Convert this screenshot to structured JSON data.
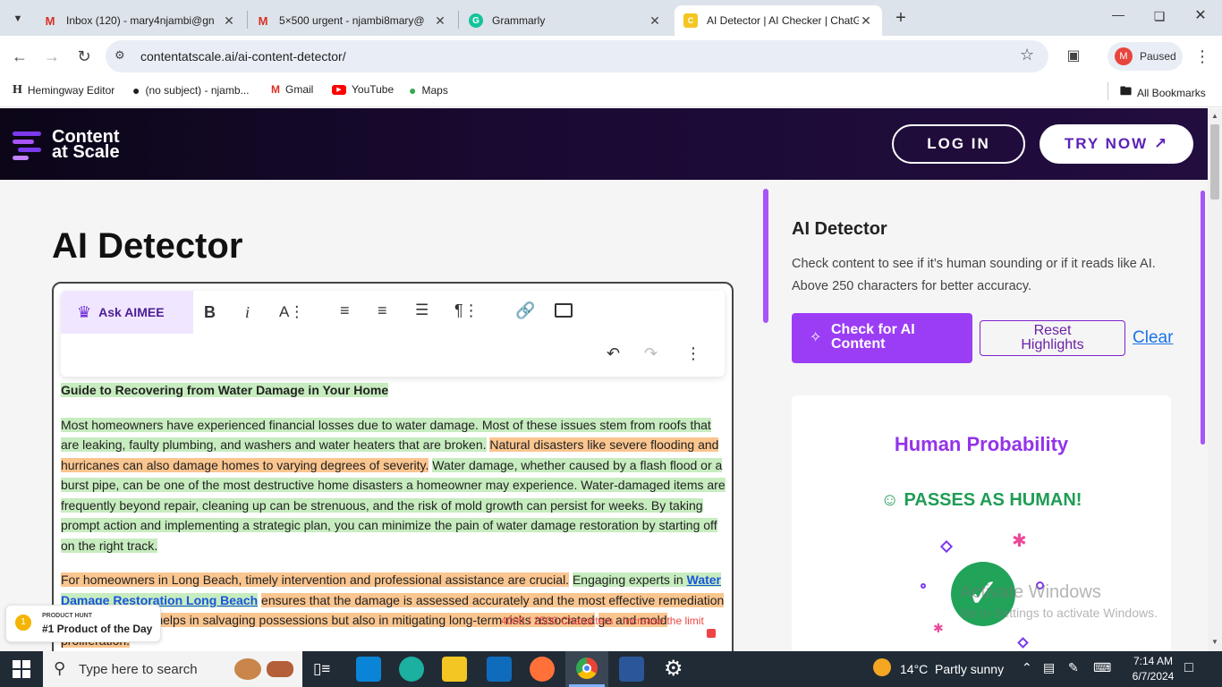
{
  "browser": {
    "tabs": [
      {
        "title": "Inbox (120) - mary4njambi@gn",
        "icon": "gmail-icon"
      },
      {
        "title": "5×500 urgent - njambi8mary@",
        "icon": "gmail-icon"
      },
      {
        "title": "Grammarly",
        "icon": "grammarly-icon"
      },
      {
        "title": "AI Detector | AI Checker | ChatG",
        "icon": "contentatscale-icon"
      }
    ],
    "url": "contentatscale.ai/ai-content-detector/",
    "profile_initial": "M",
    "profile_status": "Paused",
    "bookmarks": [
      {
        "label": "Hemingway Editor",
        "icon": "H"
      },
      {
        "label": "(no subject) - njamb...",
        "icon": ""
      },
      {
        "label": "Gmail",
        "icon": "M"
      },
      {
        "label": "YouTube",
        "icon": ""
      },
      {
        "label": "Maps",
        "icon": ""
      }
    ],
    "all_bookmarks": "All Bookmarks"
  },
  "site": {
    "logo_line1": "Content",
    "logo_line2": "at Scale",
    "login": "LOG IN",
    "try_now": "TRY NOW ↗"
  },
  "editor": {
    "page_title": "AI Detector",
    "ask_aimee": "Ask AIMEE",
    "heading": "Guide to Recovering from Water Damage in Your Home",
    "p1_green1": "Most homeowners have experienced financial losses due to water damage. Most of these issues stem from roofs that are leaking, faulty plumbing, and washers and water heaters that are broken.",
    "p1_orange": "Natural disasters like severe flooding and hurricanes can also damage homes to varying degrees of severity.",
    "p1_green2": "Water damage, whether caused by a flash flood or a burst pipe, can be one of the most destructive home disasters a homeowner may experience. Water-damaged items are frequently beyond repair, cleaning up can be strenuous, and the risk of mold growth can persist for weeks. By taking prompt action and implementing a strategic plan, you can minimize the pain of water damage restoration by starting off on the right track.",
    "p2_orange1": "For homeowners in Long Beach, timely intervention and professional assistance are crucial.",
    "p2_green_pre": "Engaging experts in",
    "p2_link": "Water Damage Restoration Long Beach",
    "p2_orange2_a": "ensures that the damage is assessed accurately and the most effective remediation",
    "p2_orange2_b": "ed. This not only helps in salvaging possessions but also in mitigating long-term risks associated",
    "p2_orange2_c": "ge and mold proliferation.",
    "char_count": "4000 / 2500 Characters - Increase the limit"
  },
  "product_hunt": {
    "small": "PRODUCT HUNT",
    "label": "#1 Product of the Day"
  },
  "detector": {
    "title": "AI Detector",
    "description": "Check content to see if it’s human sounding or if it reads like AI. Above 250 characters for better accuracy.",
    "check_btn": "Check for AI Content",
    "reset_btn": "Reset Highlights",
    "clear": "Clear",
    "result_title": "Human Probability",
    "result_status": "PASSES AS HUMAN!"
  },
  "windows": {
    "activate_title": "Activate Windows",
    "activate_sub": "Go to Settings to activate Windows.",
    "search": "Type here to search",
    "weather": "14°C  Partly sunny",
    "time": "7:14 AM",
    "date": "6/7/2024"
  },
  "colors": {
    "accent": "#9b3df5",
    "header_bg": "#150a2a",
    "highlight_green": "#c7ecbf",
    "highlight_orange": "#fbc58f",
    "human_green": "#1f9d55"
  }
}
